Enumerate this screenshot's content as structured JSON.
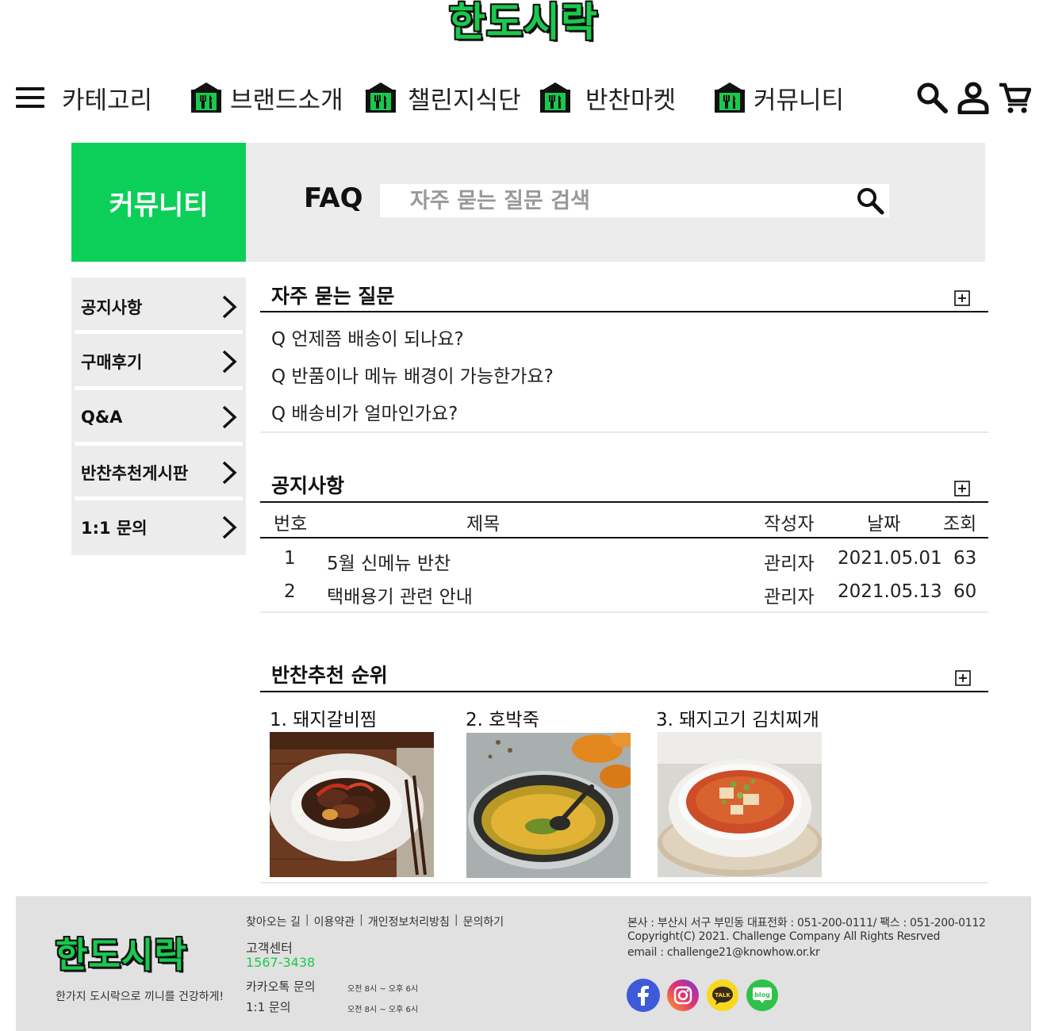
{
  "brand": {
    "logo": "한도시락",
    "slogan": "한가지 도시락으로 끼니를 건강하게!"
  },
  "nav": {
    "category": "카테고리",
    "items": [
      "브랜드소개",
      "챌린지식단",
      "반찬마켓",
      "커뮤니티"
    ],
    "icons": {
      "menu": "hamburger-icon",
      "store": "store-icon",
      "search": "search-icon",
      "user": "user-icon",
      "cart": "cart-icon"
    }
  },
  "banner": {
    "section": "커뮤니티",
    "faq_label": "FAQ",
    "search_placeholder": "자주 묻는 질문 검색"
  },
  "sidebar": {
    "items": [
      "공지사항",
      "구매후기",
      "Q&A",
      "반찬추천게시판",
      "1:1 문의"
    ]
  },
  "faq": {
    "title": "자주 묻는 질문",
    "questions": [
      "Q  언제쯤 배송이 되나요?",
      "Q  반품이나 메뉴 배경이 가능한가요?",
      "Q  배송비가 얼마인가요?"
    ]
  },
  "notice": {
    "title": "공지사항",
    "headers": [
      "번호",
      "제목",
      "작성자",
      "날짜",
      "조회"
    ],
    "rows": [
      {
        "no": "1",
        "title": "5월 신메뉴 반찬",
        "author": "관리자",
        "date": "2021.05.01",
        "views": "63"
      },
      {
        "no": "2",
        "title": "택배용기 관련 안내",
        "author": "관리자",
        "date": "2021.05.13",
        "views": "60"
      }
    ]
  },
  "ranking": {
    "title": "반찬추천 순위",
    "items": [
      "1. 돼지갈비찜",
      "2. 호박죽",
      "3. 돼지고기 김치찌개"
    ]
  },
  "footer": {
    "links": [
      "찾아오는 길",
      "이용약관",
      "개인정보처리방침",
      "문의하기"
    ],
    "cs_label": "고객센터",
    "cs_phone": "1567-3438",
    "kakao_label": "카카오톡 문의",
    "kakao_hours": "오전 8시 ~ 오후 6시",
    "qna_label": "1:1 문의",
    "qna_hours": "오전 8시 ~ 오후 6시",
    "address": "본사 : 부산시 서구 부민동  대표전화 : 051-200-0111/ 팩스 : 051-200-0112",
    "copyright": "Copyright(C) 2021. Challenge Company All Rights Resrved",
    "email": "email : challenge21@knowhow.or.kr",
    "social": [
      "facebook-icon",
      "instagram-icon",
      "kakaotalk-icon",
      "blog-icon"
    ],
    "social_text": {
      "talk": "TALK",
      "blog": "blog"
    }
  },
  "colors": {
    "brand_green": "#0ccf59",
    "panel_gray": "#ececec",
    "footer_gray": "#e1e1e1"
  }
}
